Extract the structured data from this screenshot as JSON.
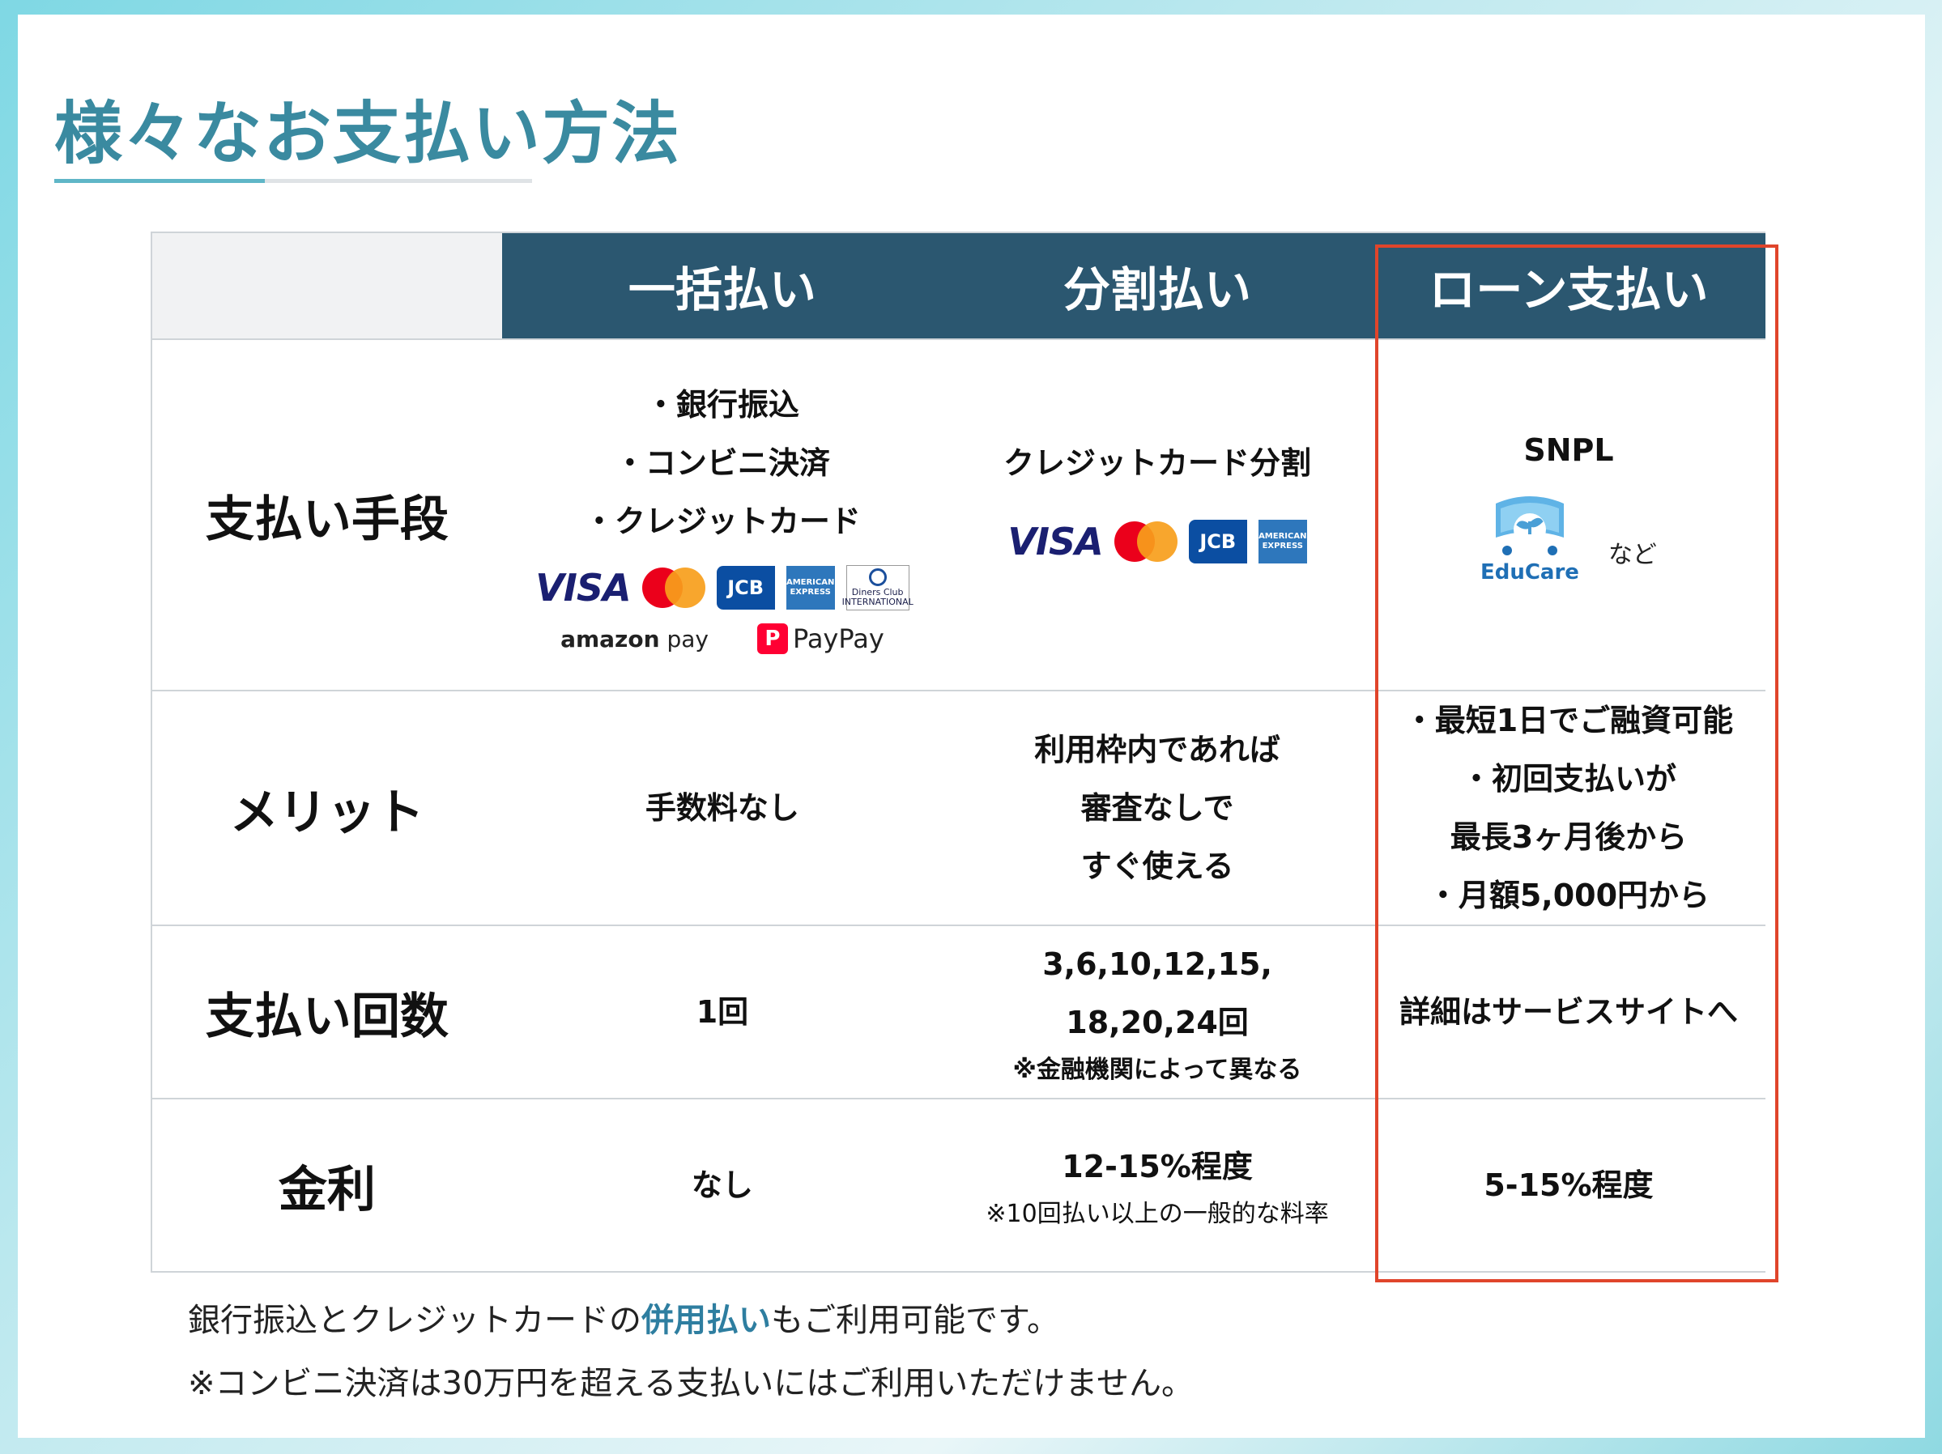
{
  "page_title": "様々なお支払い方法",
  "table": {
    "headers": [
      "",
      "一括払い",
      "分割払い",
      "ローン支払い"
    ],
    "rows": {
      "method": {
        "label": "支払い手段",
        "lump": [
          "・銀行振込",
          "・コンビニ決済",
          "・クレジットカード"
        ],
        "lump_brands": [
          "VISA",
          "JCB",
          "AMERICAN EXPRESS",
          "Diners Club INTERNATIONAL"
        ],
        "lump_amazon": "amazon",
        "lump_amazon_pay": "pay",
        "lump_paypay": "PayPay",
        "installment": "クレジットカード分割",
        "installment_brands": [
          "VISA",
          "JCB",
          "AMERICAN EXPRESS"
        ],
        "loan": "SNPL",
        "loan_logo": "EduCare",
        "loan_etc": "など"
      },
      "merit": {
        "label": "メリット",
        "lump": "手数料なし",
        "installment": [
          "利用枠内であれば",
          "審査なしで",
          "すぐ使える"
        ],
        "loan": [
          "・最短1日でご融資可能",
          "・初回支払いが",
          "最長3ヶ月後から",
          "・月額5,000円から"
        ]
      },
      "count": {
        "label": "支払い回数",
        "lump": "1回",
        "installment": [
          "3,6,10,12,15,",
          "18,20,24回"
        ],
        "installment_note": "※金融機関によって異なる",
        "loan": "詳細はサービスサイトへ"
      },
      "rate": {
        "label": "金利",
        "lump": "なし",
        "installment": "12-15%程度",
        "installment_note": "※10回払い以上の一般的な料率",
        "loan": "5-15%程度"
      }
    }
  },
  "footnotes": {
    "line1_pre": "銀行振込とクレジットカードの",
    "line1_em": "併用払い",
    "line1_post": "もご利用可能です。",
    "line2": "※コンビニ決済は30万円を超える支払いにはご利用いただけません。"
  },
  "colors": {
    "title": "#3a8aa0",
    "header_bg": "#2b5770",
    "highlight_border": "#e0452b",
    "emphasis": "#2e7ea0"
  }
}
